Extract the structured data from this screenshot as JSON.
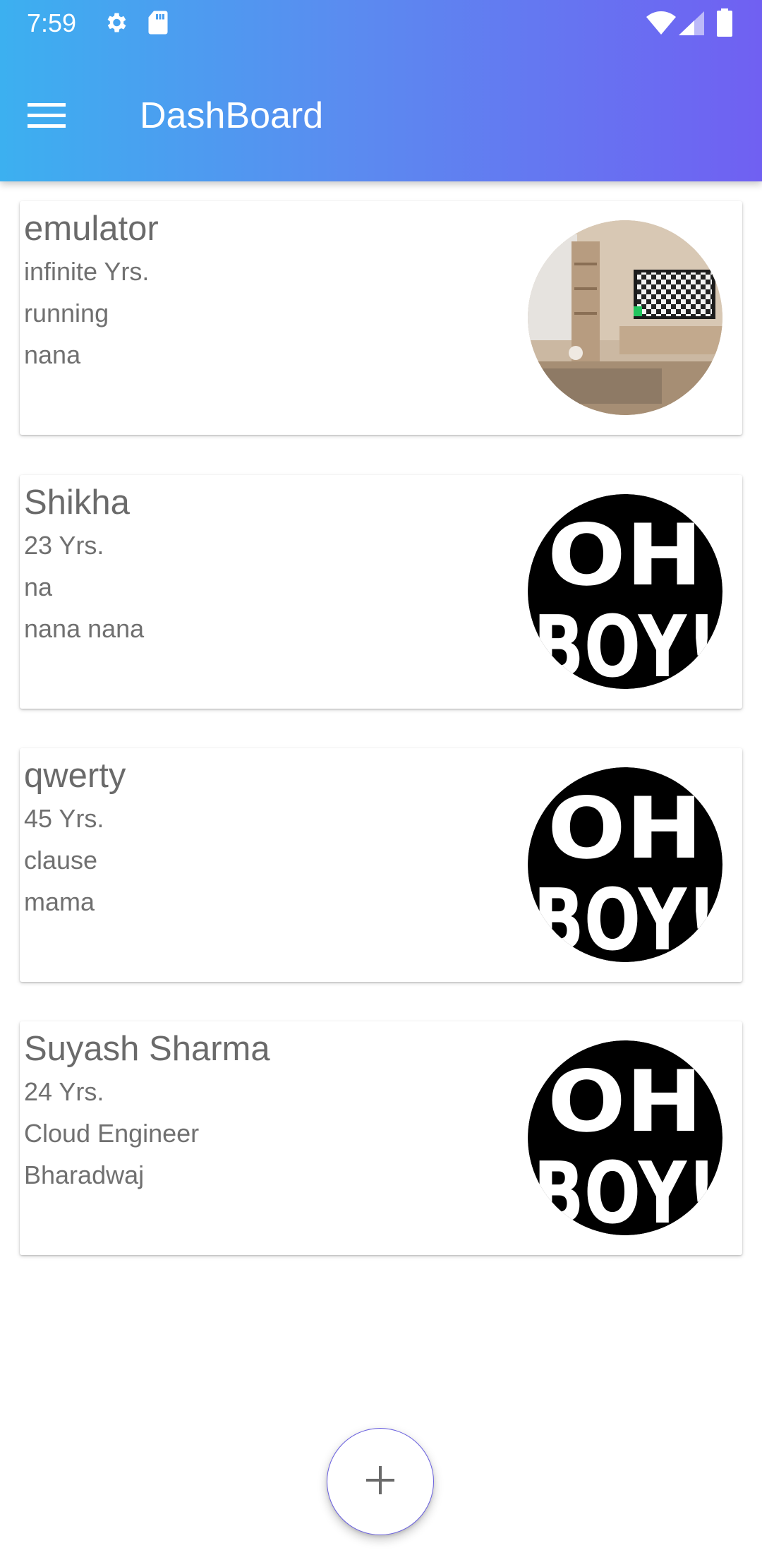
{
  "status_bar": {
    "time": "7:59",
    "icons": [
      "settings-icon",
      "sd-card-icon",
      "wifi-icon",
      "cell-signal-icon",
      "battery-icon"
    ]
  },
  "app_bar": {
    "title": "DashBoard",
    "menu_icon": "hamburger-menu-icon",
    "gradient": [
      "#3cb0f0",
      "#7060f2"
    ]
  },
  "profiles": [
    {
      "name": "emulator",
      "age": "infinite Yrs.",
      "occupation": "running",
      "surname": "nana",
      "avatar": "room-photo"
    },
    {
      "name": "Shikha",
      "age": "23 Yrs.",
      "occupation": "na",
      "surname": "nana nana",
      "avatar": "oh-boy-logo"
    },
    {
      "name": "qwerty",
      "age": "45 Yrs.",
      "occupation": "clause",
      "surname": "mama",
      "avatar": "oh-boy-logo"
    },
    {
      "name": "Suyash Sharma",
      "age": "24 Yrs.",
      "occupation": "Cloud Engineer",
      "surname": "Bharadwaj",
      "avatar": "oh-boy-logo"
    }
  ],
  "fab": {
    "icon": "plus-icon",
    "border_color": "#6a60e0"
  },
  "colors": {
    "text_primary": "#6a6a6a",
    "text_secondary": "#707070"
  }
}
